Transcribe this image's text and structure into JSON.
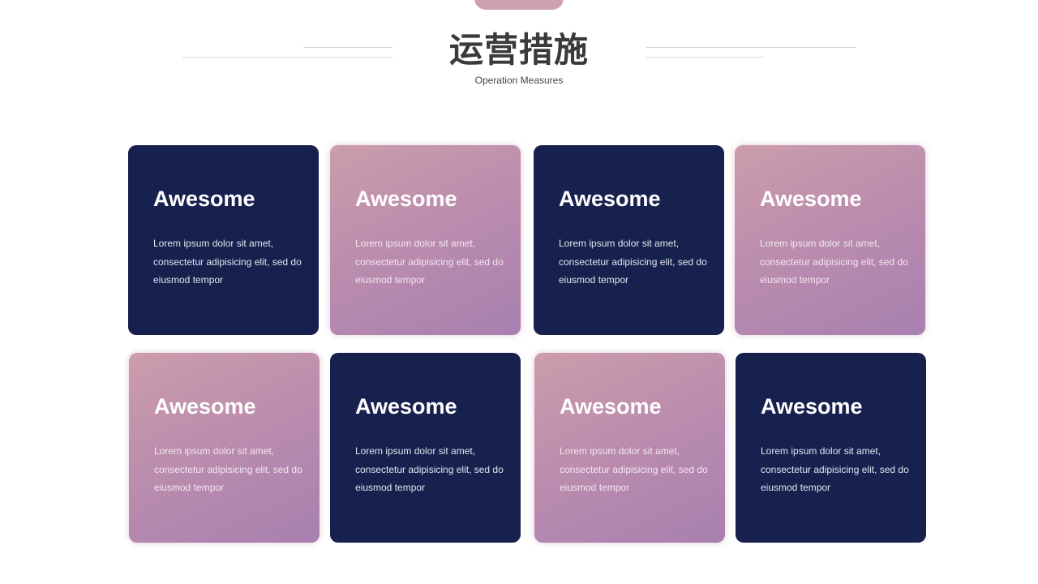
{
  "header": {
    "title": "运营措施",
    "subtitle": "Operation Measures"
  },
  "colors": {
    "navy": "#17214e",
    "pink_start": "#cc9dab",
    "pink_end": "#a880b0",
    "accent_tab": "#cfa1ae"
  },
  "cards": [
    {
      "title": "Awesome",
      "body": "Lorem ipsum dolor sit amet, consectetur adipisicing elit, sed do eiusmod tempor",
      "style": "navy"
    },
    {
      "title": "Awesome",
      "body": "Lorem ipsum dolor sit amet, consectetur adipisicing elit, sed do eiusmod tempor",
      "style": "pink"
    },
    {
      "title": "Awesome",
      "body": "Lorem ipsum dolor sit amet, consectetur adipisicing elit, sed do eiusmod tempor",
      "style": "navy"
    },
    {
      "title": "Awesome",
      "body": "Lorem ipsum dolor sit amet, consectetur adipisicing elit, sed do eiusmod tempor",
      "style": "pink"
    },
    {
      "title": "Awesome",
      "body": "Lorem ipsum dolor sit amet, consectetur adipisicing elit, sed do eiusmod tempor",
      "style": "pink"
    },
    {
      "title": "Awesome",
      "body": "Lorem ipsum dolor sit amet, consectetur adipisicing elit, sed do eiusmod tempor",
      "style": "navy"
    },
    {
      "title": "Awesome",
      "body": "Lorem ipsum dolor sit amet, consectetur adipisicing elit, sed do eiusmod tempor",
      "style": "pink"
    },
    {
      "title": "Awesome",
      "body": "Lorem ipsum dolor sit amet, consectetur adipisicing elit, sed do eiusmod tempor",
      "style": "navy"
    }
  ]
}
